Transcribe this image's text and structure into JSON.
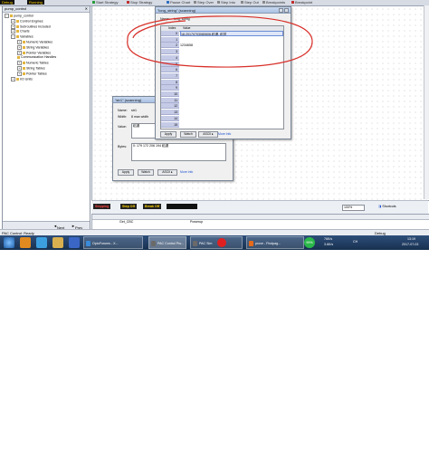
{
  "toolbar": {
    "items": [
      "Debug",
      "Start Strategy",
      "Stop Strategy",
      "Pause Chart",
      "Step Over",
      "Step Into",
      "Step Out",
      "Breakpoints",
      "Breakpoint"
    ],
    "status_dark_1": "Debug",
    "status_dark_2": "Running"
  },
  "left_panel": {
    "title": "pump_control",
    "tree": [
      {
        "label": "pump_control",
        "indent": 0,
        "expander": "−"
      },
      {
        "label": "Control Engines",
        "indent": 1,
        "expander": "+"
      },
      {
        "label": "Subroutines Included",
        "indent": 1,
        "expander": "+"
      },
      {
        "label": "Charts",
        "indent": 1,
        "expander": "+"
      },
      {
        "label": "Variables",
        "indent": 1,
        "expander": "−"
      },
      {
        "label": "Numeric Variables",
        "indent": 2,
        "expander": "+"
      },
      {
        "label": "String Variables",
        "indent": 2,
        "expander": "+"
      },
      {
        "label": "Pointer Variables",
        "indent": 2,
        "expander": "+"
      },
      {
        "label": "Communication Handles",
        "indent": 2,
        "expander": ""
      },
      {
        "label": "Numeric Tables",
        "indent": 2,
        "expander": "+"
      },
      {
        "label": "String Tables",
        "indent": 2,
        "expander": "+"
      },
      {
        "label": "Pointer Tables",
        "indent": 2,
        "expander": "+"
      },
      {
        "label": "I/O Units",
        "indent": 1,
        "expander": "+"
      }
    ],
    "next": "Next",
    "prev": "Prev"
  },
  "long_string_dialog": {
    "title": "\"long_string\" (scanning)",
    "name_label": "Name:",
    "name_value": "long_string",
    "col_index": "Index",
    "col_value": "Value",
    "rows": [
      {
        "index": "0",
        "value": "18,20170703080606,稻逼, 稻芄"
      },
      {
        "index": "1",
        "value": ""
      },
      {
        "index": "2",
        "value": "1234658"
      },
      {
        "index": "3",
        "value": ""
      },
      {
        "index": "4",
        "value": ""
      },
      {
        "index": "5",
        "value": ""
      },
      {
        "index": "6",
        "value": ""
      },
      {
        "index": "7",
        "value": ""
      },
      {
        "index": "8",
        "value": ""
      },
      {
        "index": "9",
        "value": ""
      },
      {
        "index": "10",
        "value": ""
      },
      {
        "index": "11",
        "value": ""
      },
      {
        "index": "12",
        "value": ""
      },
      {
        "index": "13",
        "value": ""
      },
      {
        "index": "14",
        "value": ""
      },
      {
        "index": "15",
        "value": ""
      }
    ],
    "apply": "Apply",
    "watch": "Watch",
    "ascii": "ASCII ▸",
    "more_info": "More Info"
  },
  "str1_dialog": {
    "title": "\"str1\" (scanning)",
    "name_label": "Name:",
    "name_value": "str1",
    "width_label": "Width:",
    "width_value": "8 max width",
    "value_label": "Value:",
    "value_text": "稻逼",
    "bytes_label": "Bytes:",
    "bytes_text": "0: 179 172 206 194   稻逼",
    "apply": "Apply",
    "watch": "Watch",
    "ascii": "ASCII ▸",
    "more_info": "More Info"
  },
  "annotation_color": "#d8302a",
  "mode_strip": {
    "stepping": "Stepping",
    "step_off": "Step Off",
    "break_off": "Break Off"
  },
  "zoom": "100%",
  "shortcuts": "Shortcuts",
  "bottom_list": {
    "col1": "Get_CBC",
    "col2": "Powerup"
  },
  "statusbar": {
    "left": "PAC Control: Ready",
    "mode": "Debug"
  },
  "taskbar": {
    "apps": [
      "OptoForums - X...",
      "PAC Control Pro...",
      "PAC Sim",
      "prove - Findpag..."
    ],
    "active_index": 1,
    "tray_percent": "99%",
    "tray_speed_1": "76K/s",
    "tray_speed_2": "3.6K/s",
    "time": "13:19",
    "date": "2017-07-03",
    "lang": "CH"
  }
}
